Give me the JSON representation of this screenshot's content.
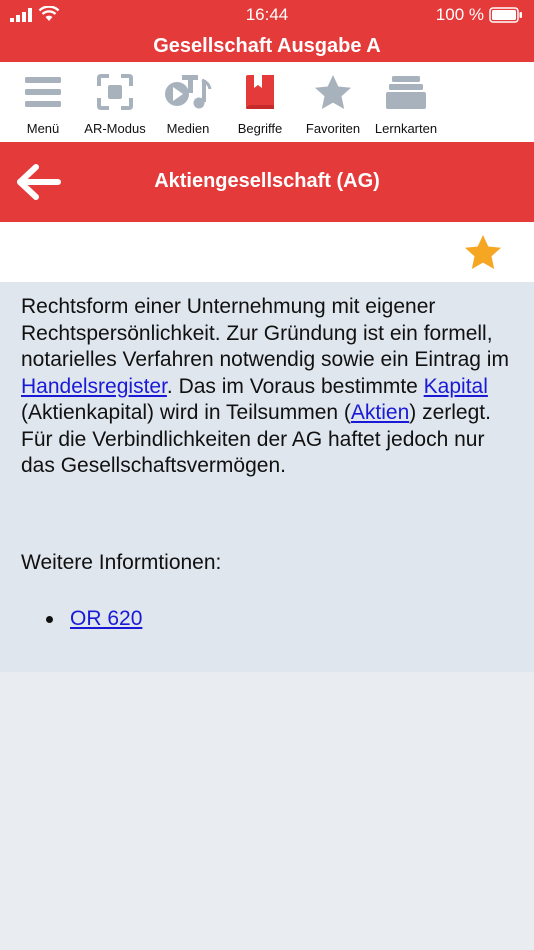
{
  "status_bar": {
    "time": "16:44",
    "battery": "100 %"
  },
  "app": {
    "title": "Gesellschaft Ausgabe A"
  },
  "toolbar": {
    "items": [
      {
        "label": "Menü",
        "icon": "menu-icon"
      },
      {
        "label": "AR-Modus",
        "icon": "ar-scan-icon"
      },
      {
        "label": "Medien",
        "icon": "media-icon"
      },
      {
        "label": "Begriffe",
        "icon": "book-icon"
      },
      {
        "label": "Favoriten",
        "icon": "star-icon"
      },
      {
        "label": "Lernkarten",
        "icon": "flashcards-icon"
      }
    ]
  },
  "header": {
    "title": "Aktiengesellschaft (AG)",
    "back_icon": "back-arrow-icon"
  },
  "favorite": {
    "icon": "star-icon",
    "color": "#f5a623"
  },
  "article": {
    "t1": "Rechtsform einer Unternehmung mit eigener Rechtspersönlichkeit. Zur Gründung ist ein formell, notarielles Verfahren notwendig sowie ein Eintrag im ",
    "link_handelsregister": "Handelsregister",
    "t2": ". Das im Voraus bestimmte ",
    "link_kapital": "Kapital",
    "t3": " (Aktienkapital) wird in Teilsummen (",
    "link_aktien": "Aktien",
    "t4": ") zerlegt. Für die Verbindlichkeiten der AG haftet jedoch nur das Gesellschaftsvermögen.",
    "more_label": "Weitere Informtionen:",
    "links": [
      "OR 620"
    ]
  },
  "colors": {
    "accent": "#e43a3a",
    "link": "#1a1ad6",
    "icon_grey": "#a8b2bd",
    "active_icon": "#e43a3a"
  }
}
